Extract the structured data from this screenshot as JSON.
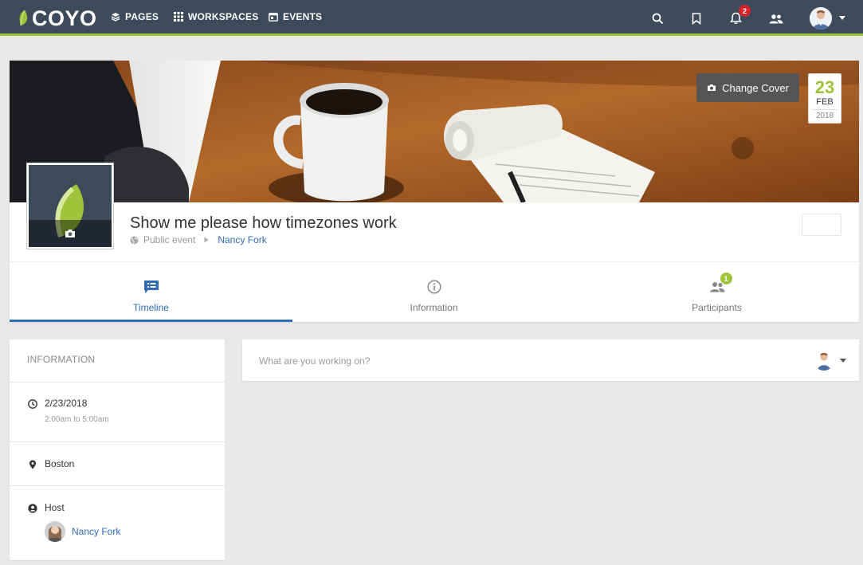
{
  "nav": {
    "logo": "COYO",
    "items": [
      {
        "label": "PAGES",
        "icon": "layers-icon"
      },
      {
        "label": "WORKSPACES",
        "icon": "grid-icon"
      },
      {
        "label": "EVENTS",
        "icon": "calendar-icon"
      }
    ],
    "notification_count": "2"
  },
  "cover": {
    "change_cover_label": "Change Cover",
    "date": {
      "day": "23",
      "month": "FEB",
      "year": "2018"
    }
  },
  "event": {
    "title": "Show me please how timezones work",
    "visibility": "Public event",
    "owner": "Nancy Fork"
  },
  "tabs": [
    {
      "label": "Timeline",
      "icon": "timeline-icon",
      "active": true
    },
    {
      "label": "Information",
      "icon": "info-icon",
      "active": false
    },
    {
      "label": "Participants",
      "icon": "participants-icon",
      "active": false,
      "badge": "1"
    }
  ],
  "info": {
    "heading": "INFORMATION",
    "date": "2/23/2018",
    "time": "2:00am to 5:00am",
    "location": "Boston",
    "host_label": "Host",
    "host_name": "Nancy Fork"
  },
  "composer": {
    "placeholder": "What are you working on?"
  },
  "colors": {
    "nav_bg": "#3c4a59",
    "accent_green": "#9fc33b",
    "link_blue": "#2f6db5",
    "badge_red": "#d8232a"
  }
}
